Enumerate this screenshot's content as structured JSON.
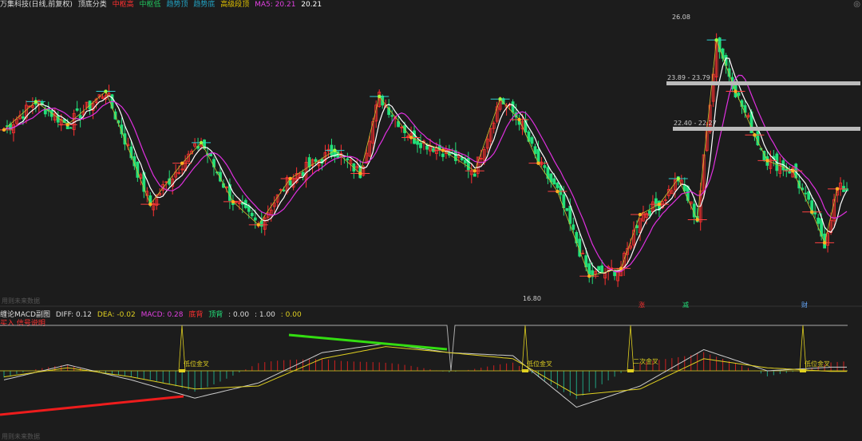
{
  "main_header": {
    "title": "万集科技(日线,前复权)",
    "indicator": "顶底分类",
    "items": [
      {
        "label": "中枢高",
        "color": "#ff3030"
      },
      {
        "label": "中枢低",
        "color": "#22c55e"
      },
      {
        "label": "趋势顶",
        "color": "#22a0c0"
      },
      {
        "label": "趋势底",
        "color": "#22a0c0"
      },
      {
        "label": "高级段顶",
        "color": "#e0c000"
      }
    ],
    "ma5_label": "MA5: 20.21",
    "ma5_color": "#e040e0",
    "close_label": "20.21"
  },
  "sub_header": {
    "title": "缠论MACD副图",
    "diff_label": "DIFF: 0.12",
    "dea_label": "DEA: -0.02",
    "macd_label": "MACD: 0.28",
    "item4": "底背",
    "item5": "顶背",
    "val1": ": 0.00",
    "val2": ": 1.00",
    "val3": ": 0.00",
    "line2": "买入 信号说明"
  },
  "footer_main": "用则未来数据",
  "footer_sub": "用则未来数据",
  "annotations": {
    "price_high": "26.08",
    "price_low": "16.80",
    "zone1": "23.89 - 23.79",
    "zone2": "22.40 - 22.27",
    "golden_cross_1": "低位金叉",
    "golden_cross_2": "低位金叉",
    "golden_cross_3": "二次金叉",
    "golden_cross_4": "低位金叉",
    "marker_up": "涨",
    "marker_down": "减",
    "marker_fin": "财"
  },
  "colors": {
    "up": "#ff3030",
    "down": "#22e07a",
    "ma_white": "#ffffff",
    "ma_magenta": "#e030e0",
    "zigzag_yellow": "#c8c030",
    "zigzag_red": "#e05050",
    "diff": "#cccccc",
    "dea": "#e0d020",
    "div_green": "#33dd11",
    "div_red": "#ee1c1c"
  },
  "chart_data": [
    {
      "type": "candlestick",
      "title": "万集科技(日线,前复权)",
      "ylim": [
        16.0,
        27.0
      ],
      "series": [
        {
          "name": "close_pivots",
          "x": [
            0,
            10,
            20,
            32,
            46,
            56,
            62,
            72,
            80,
            90,
            104,
            112,
            118,
            128,
            138,
            148,
            156,
            162,
            168,
            174,
            184,
            194,
            200,
            206,
            212,
            218,
            224,
            230,
            236,
            240,
            248,
            254,
            258,
            262
          ],
          "values": [
            22.5,
            23.6,
            22.7,
            24.0,
            19.6,
            21.2,
            22.0,
            19.7,
            18.8,
            20.6,
            21.7,
            20.8,
            23.8,
            22.2,
            21.7,
            20.9,
            23.7,
            22.9,
            21.2,
            20.1,
            16.8,
            17.1,
            19.2,
            19.6,
            20.6,
            19.0,
            26.0,
            24.0,
            22.3,
            21.3,
            20.9,
            19.3,
            18.1,
            20.2
          ]
        }
      ]
    },
    {
      "type": "bar",
      "title": "缠论MACD副图",
      "ylim": [
        -1.5,
        1.2
      ],
      "series": [
        {
          "name": "DIFF",
          "x": [
            0,
            20,
            40,
            60,
            80,
            100,
            120,
            140,
            160,
            180,
            200,
            220,
            240,
            260
          ],
          "values": [
            -0.3,
            0.2,
            -0.3,
            -0.9,
            -0.4,
            0.6,
            0.9,
            0.6,
            0.5,
            -1.2,
            -0.5,
            0.7,
            0.0,
            0.12
          ]
        },
        {
          "name": "DEA",
          "x": [
            0,
            20,
            40,
            60,
            80,
            100,
            120,
            140,
            160,
            180,
            200,
            220,
            240,
            260
          ],
          "values": [
            -0.2,
            0.1,
            -0.2,
            -0.6,
            -0.5,
            0.4,
            0.8,
            0.6,
            0.4,
            -0.8,
            -0.6,
            0.4,
            0.1,
            -0.02
          ]
        }
      ]
    }
  ]
}
